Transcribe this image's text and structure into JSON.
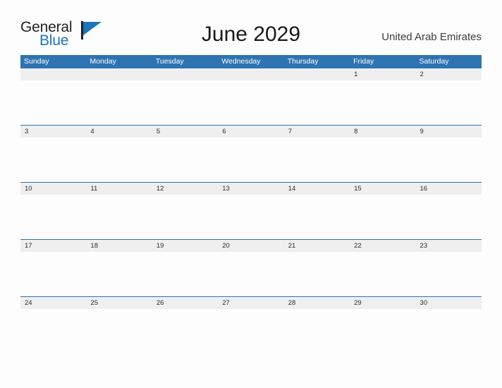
{
  "brand": {
    "name_top": "General",
    "name_bottom": "Blue",
    "accent_color": "#1B75BB",
    "flag_icon": "flag-triangle-icon"
  },
  "header": {
    "title": "June 2029",
    "region": "United Arab Emirates"
  },
  "colors": {
    "header_blue": "#2E73B2",
    "date_band_gray": "#EFEFEF",
    "page_background": "#FDFDFD",
    "title_text": "#1A1A1A",
    "region_text": "#3B3B3B"
  },
  "calendar": {
    "month": "June",
    "year": "2029",
    "day_headers": [
      "Sunday",
      "Monday",
      "Tuesday",
      "Wednesday",
      "Thursday",
      "Friday",
      "Saturday"
    ],
    "weeks": [
      [
        "",
        "",
        "",
        "",
        "",
        "1",
        "2"
      ],
      [
        "3",
        "4",
        "5",
        "6",
        "7",
        "8",
        "9"
      ],
      [
        "10",
        "11",
        "12",
        "13",
        "14",
        "15",
        "16"
      ],
      [
        "17",
        "18",
        "19",
        "20",
        "21",
        "22",
        "23"
      ],
      [
        "24",
        "25",
        "26",
        "27",
        "28",
        "29",
        "30"
      ]
    ]
  }
}
